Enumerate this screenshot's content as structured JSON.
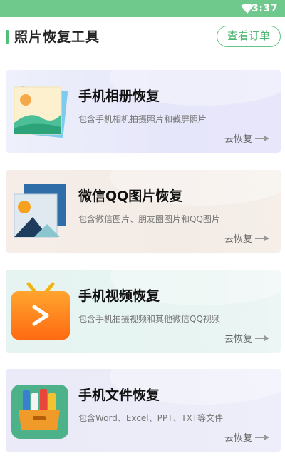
{
  "status_bar": {
    "time": "3:37",
    "icons": [
      "wifi-icon"
    ]
  },
  "header": {
    "title": "照片恢复工具",
    "orders_button": "查看订单"
  },
  "cards": [
    {
      "title": "手机相册恢复",
      "description": "包含手机相机拍摄照片和截屏照片",
      "action": "去恢复",
      "icon": "photo-album-icon"
    },
    {
      "title": "微信QQ图片恢复",
      "description": "包含微信图片、朋友圈图片和QQ图片",
      "action": "去恢复",
      "icon": "picture-icon"
    },
    {
      "title": "手机视频恢复",
      "description": "包含手机拍摄视频和其他微信QQ视频",
      "action": "去恢复",
      "icon": "video-icon"
    },
    {
      "title": "手机文件恢复",
      "description": "包含Word、Excel、PPT、TXT等文件",
      "action": "去恢复",
      "icon": "file-box-icon"
    }
  ],
  "colors": {
    "accent": "#52bf78",
    "status_bar": "#6fc98c"
  }
}
